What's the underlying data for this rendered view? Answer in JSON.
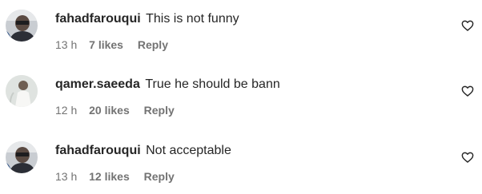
{
  "comments": [
    {
      "username": "fahadfarouqui",
      "text": "This is not funny",
      "time": "13 h",
      "likes": "7 likes",
      "reply": "Reply",
      "avatar": "avatar-dark-portrait"
    },
    {
      "username": "qamer.saeeda",
      "text": "True he should be bann",
      "time": "12 h",
      "likes": "20 likes",
      "reply": "Reply",
      "avatar": "avatar-light-figure"
    },
    {
      "username": "fahadfarouqui",
      "text": "Not acceptable",
      "time": "13 h",
      "likes": "12 likes",
      "reply": "Reply",
      "avatar": "avatar-dark-portrait"
    }
  ],
  "icons": {
    "like": "heart-outline-icon"
  },
  "colors": {
    "text_primary": "#262626",
    "text_secondary": "#737373",
    "background": "#ffffff"
  }
}
